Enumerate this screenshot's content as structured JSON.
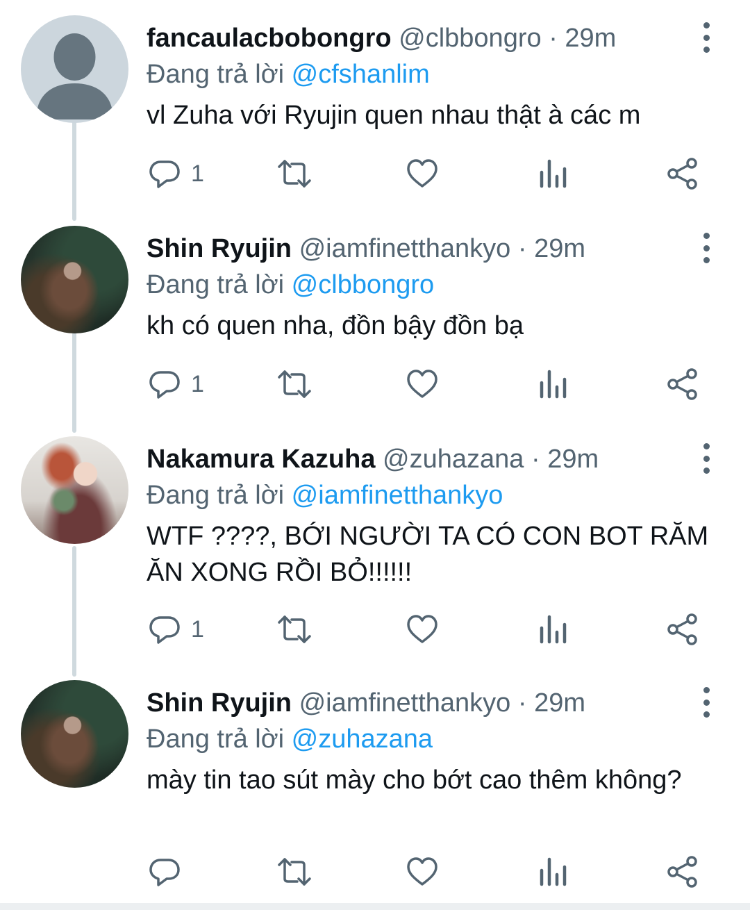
{
  "replying_prefix": "Đang trả lời",
  "tweets": [
    {
      "name": "fancaulacbobongro",
      "handle": "@clbbongro",
      "dot": "·",
      "time": "29m",
      "replying_to": "@cfshanlim",
      "text": "vl Zuha với Ryujin quen nhau thật à các m",
      "reply_count": "1",
      "avatar": "default-avatar"
    },
    {
      "name": "Shin Ryujin",
      "handle": "@iamfinetthankyo",
      "dot": "·",
      "time": "29m",
      "replying_to": "@clbbongro",
      "text": "kh có quen nha, đồn bậy đồn bạ",
      "reply_count": "1",
      "avatar": "photo-dark"
    },
    {
      "name": "Nakamura Kazuha",
      "handle": "@zuhazana",
      "dot": "·",
      "time": "29m",
      "replying_to": "@iamfinetthankyo",
      "text": "WTF ????, BỚI NGƯỜI TA CÓ CON BOT RĂM ĂN XONG RỒI BỎ!!!!!!",
      "reply_count": "1",
      "avatar": "photo-light"
    },
    {
      "name": "Shin Ryujin",
      "handle": "@iamfinetthankyo",
      "dot": "·",
      "time": "29m",
      "replying_to": "@zuhazana",
      "text": "mày tin tao sút mày cho bớt cao thêm không?",
      "reply_count": "",
      "avatar": "photo-dark"
    }
  ],
  "colors": {
    "text_primary": "#0f1419",
    "text_secondary": "#536471",
    "mention": "#1d9bf0",
    "thread_line": "#cfd9de"
  },
  "icons": [
    "more-vertical-icon",
    "reply-icon",
    "retweet-icon",
    "like-icon",
    "analytics-icon",
    "share-icon"
  ]
}
